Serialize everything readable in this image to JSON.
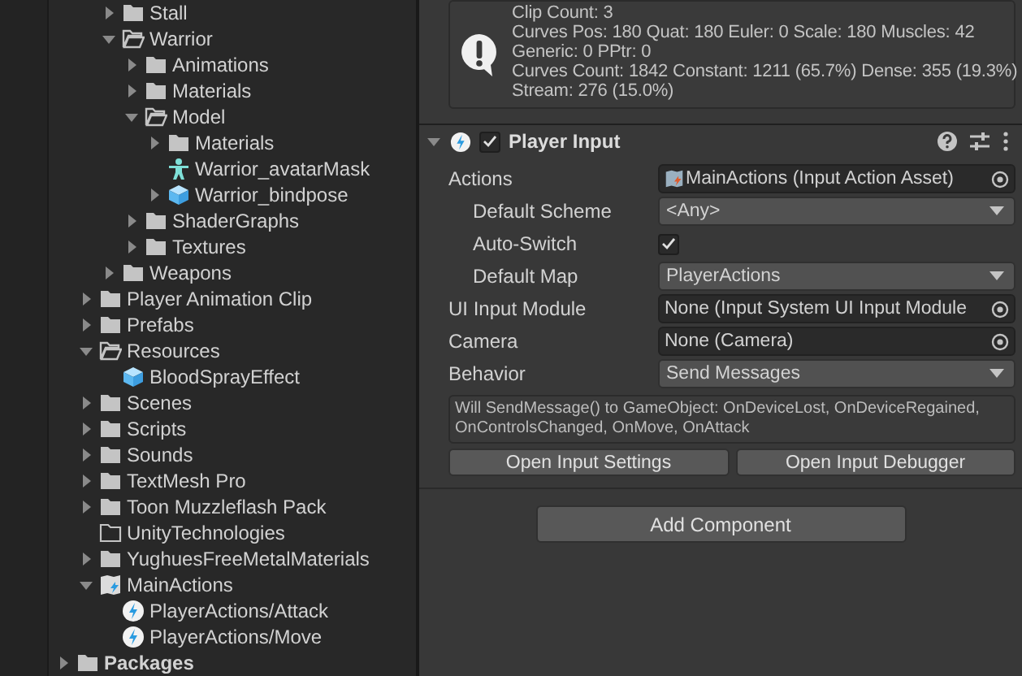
{
  "project_tree": {
    "nested_items": [
      {
        "label": "Stall",
        "kind": "folder",
        "expanded": false
      },
      {
        "label": "Warrior",
        "kind": "folder",
        "expanded": true,
        "children": [
          {
            "label": "Animations",
            "kind": "folder",
            "expanded": false
          },
          {
            "label": "Materials",
            "kind": "folder",
            "expanded": false
          },
          {
            "label": "Model",
            "kind": "folder",
            "expanded": true,
            "children": [
              {
                "label": "Materials",
                "kind": "folder",
                "expanded": false
              },
              {
                "label": "Warrior_avatarMask",
                "kind": "avatar_mask"
              },
              {
                "label": "Warrior_bindpose",
                "kind": "prefab",
                "expanded": false
              }
            ]
          },
          {
            "label": "ShaderGraphs",
            "kind": "folder",
            "expanded": false
          },
          {
            "label": "Textures",
            "kind": "folder",
            "expanded": false
          }
        ]
      },
      {
        "label": "Weapons",
        "kind": "folder",
        "expanded": false
      }
    ],
    "asset_items": [
      {
        "label": "Player Animation Clip",
        "kind": "folder",
        "expanded": false
      },
      {
        "label": "Prefabs",
        "kind": "folder",
        "expanded": false
      },
      {
        "label": "Resources",
        "kind": "folder",
        "expanded": true,
        "children": [
          {
            "label": "BloodSprayEffect",
            "kind": "prefab"
          }
        ]
      },
      {
        "label": "Scenes",
        "kind": "folder",
        "expanded": false
      },
      {
        "label": "Scripts",
        "kind": "folder",
        "expanded": false
      },
      {
        "label": "Sounds",
        "kind": "folder",
        "expanded": false
      },
      {
        "label": "TextMesh Pro",
        "kind": "folder",
        "expanded": false
      },
      {
        "label": "Toon Muzzleflash Pack",
        "kind": "folder",
        "expanded": false
      },
      {
        "label": "UnityTechnologies",
        "kind": "empty_folder"
      },
      {
        "label": "YughuesFreeMetalMaterials",
        "kind": "folder",
        "expanded": false
      },
      {
        "label": "MainActions",
        "kind": "input_asset",
        "expanded": true,
        "children": [
          {
            "label": "PlayerActions/Attack",
            "kind": "input_action"
          },
          {
            "label": "PlayerActions/Move",
            "kind": "input_action"
          }
        ]
      }
    ],
    "root_items": [
      {
        "label": "Packages",
        "kind": "folder",
        "expanded": false
      }
    ]
  },
  "info_box": {
    "lines": [
      "Clip Count: 3",
      "Curves Pos: 180 Quat: 180 Euler: 0 Scale: 180 Muscles: 42",
      "Generic: 0 PPtr: 0",
      "Curves Count: 1842 Constant: 1211 (65.7%) Dense: 355 (19.3%)",
      "Stream: 276 (15.0%)"
    ]
  },
  "component": {
    "title": "Player Input",
    "expanded": true,
    "enabled": true,
    "properties": [
      {
        "label": "Actions",
        "kind": "asset",
        "value": "MainActions (Input Action Asset)",
        "indented": false
      },
      {
        "label": "Default Scheme",
        "kind": "dropdown",
        "value": "<Any>",
        "indented": true
      },
      {
        "label": "Auto-Switch",
        "kind": "checkbox",
        "checked": true,
        "indented": true
      },
      {
        "label": "Default Map",
        "kind": "dropdown",
        "value": "PlayerActions",
        "indented": true
      },
      {
        "label": "UI Input Module",
        "kind": "object",
        "value": "None (Input System UI Input Module",
        "indented": false
      },
      {
        "label": "Camera",
        "kind": "object",
        "value": "None (Camera)",
        "indented": false
      },
      {
        "label": "Behavior",
        "kind": "dropdown",
        "value": "Send Messages",
        "indented": false
      }
    ],
    "help_text": "Will SendMessage() to GameObject: OnDeviceLost, OnDeviceRegained, OnControlsChanged, OnMove, OnAttack",
    "buttons": [
      "Open Input Settings",
      "Open Input Debugger"
    ]
  },
  "add_component": "Add Component"
}
